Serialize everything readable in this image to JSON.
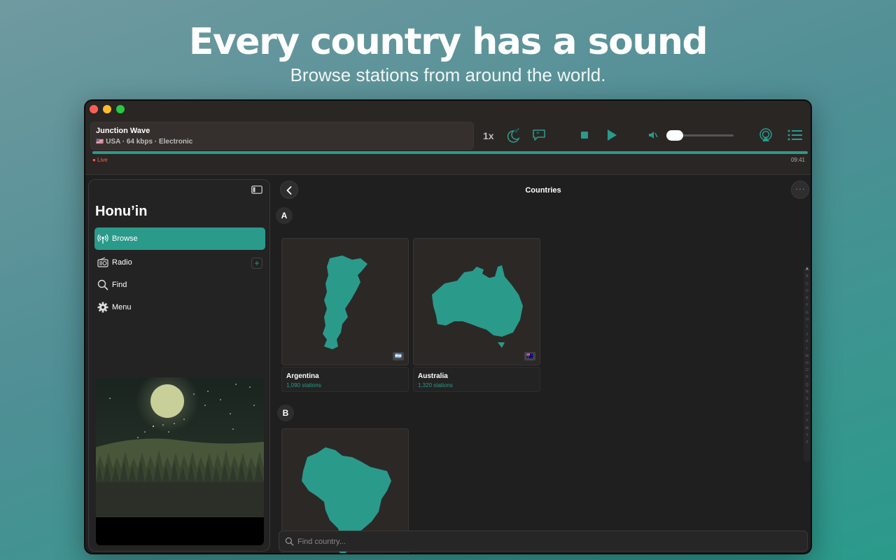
{
  "hero": {
    "title": "Every country has a sound",
    "subtitle": "Browse stations from around the world."
  },
  "player": {
    "station_name": "Junction Wave",
    "flag": "🇺🇸",
    "meta": "USA · 64 kbps · Electronic",
    "speed_label": "1x",
    "live_label": "● Live",
    "elapsed_time": "09:41",
    "volume_fraction": 0.1,
    "icons": [
      "sleep-timer-icon",
      "quote-icon",
      "stop-icon",
      "play-icon",
      "mute-icon",
      "airplay-icon",
      "queue-list-icon"
    ]
  },
  "sidebar": {
    "app_name": "Honu’in",
    "items": [
      {
        "label": "Browse",
        "icon": "broadcast-icon",
        "active": true
      },
      {
        "label": "Radio",
        "icon": "radio-icon",
        "active": false,
        "add": "+"
      },
      {
        "label": "Find",
        "icon": "search-icon",
        "active": false
      },
      {
        "label": "Menu",
        "icon": "gear-icon",
        "active": false
      }
    ]
  },
  "main": {
    "title": "Countries",
    "more_label": "···",
    "sections": [
      {
        "letter": "A",
        "countries": [
          {
            "name": "Argentina",
            "stations": "1,090 stations",
            "flag": "🇦🇷"
          },
          {
            "name": "Australia",
            "stations": "1,320 stations",
            "flag": "🇦🇺"
          }
        ]
      },
      {
        "letter": "B",
        "countries": [
          {
            "name": "Brazil",
            "flag": "🇧🇷"
          }
        ]
      }
    ],
    "index_letters": [
      "A",
      "B",
      "C",
      "D",
      "E",
      "F",
      "G",
      "H",
      "I",
      "J",
      "K",
      "L",
      "M",
      "N",
      "O",
      "P",
      "Q",
      "R",
      "S",
      "T",
      "U",
      "V",
      "W",
      "Y",
      "Z"
    ],
    "search_placeholder": "Find country..."
  },
  "colors": {
    "accent": "#2a9a8b",
    "window_bg": "#1f1f1f",
    "live_red": "#ff5f57"
  }
}
